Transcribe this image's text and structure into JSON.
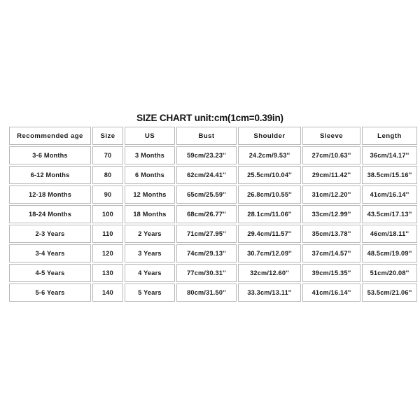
{
  "title": "SIZE CHART unit:cm(1cm=0.39in)",
  "chart_data": {
    "type": "table",
    "title": "SIZE CHART unit:cm(1cm=0.39in)",
    "columns": [
      "Recommended age",
      "Size",
      "US",
      "Bust",
      "Shoulder",
      "Sleeve",
      "Length"
    ],
    "rows": [
      [
        "3-6 Months",
        "70",
        "3 Months",
        "59cm/23.23''",
        "24.2cm/9.53''",
        "27cm/10.63''",
        "36cm/14.17''"
      ],
      [
        "6-12 Months",
        "80",
        "6 Months",
        "62cm/24.41''",
        "25.5cm/10.04''",
        "29cm/11.42''",
        "38.5cm/15.16''"
      ],
      [
        "12-18 Months",
        "90",
        "12 Months",
        "65cm/25.59''",
        "26.8cm/10.55''",
        "31cm/12.20''",
        "41cm/16.14''"
      ],
      [
        "18-24 Months",
        "100",
        "18 Months",
        "68cm/26.77''",
        "28.1cm/11.06''",
        "33cm/12.99''",
        "43.5cm/17.13''"
      ],
      [
        "2-3 Years",
        "110",
        "2 Years",
        "71cm/27.95''",
        "29.4cm/11.57''",
        "35cm/13.78''",
        "46cm/18.11''"
      ],
      [
        "3-4 Years",
        "120",
        "3 Years",
        "74cm/29.13''",
        "30.7cm/12.09''",
        "37cm/14.57''",
        "48.5cm/19.09''"
      ],
      [
        "4-5 Years",
        "130",
        "4 Years",
        "77cm/30.31''",
        "32cm/12.60''",
        "39cm/15.35''",
        "51cm/20.08''"
      ],
      [
        "5-6 Years",
        "140",
        "5 Years",
        "80cm/31.50''",
        "33.3cm/13.11''",
        "41cm/16.14''",
        "53.5cm/21.06''"
      ]
    ],
    "unit_note": "unit:cm(1cm=0.39in)",
    "colors": {
      "background": "#ffffff",
      "text": "#1a1a1a",
      "border": "#b8b8b8"
    }
  }
}
